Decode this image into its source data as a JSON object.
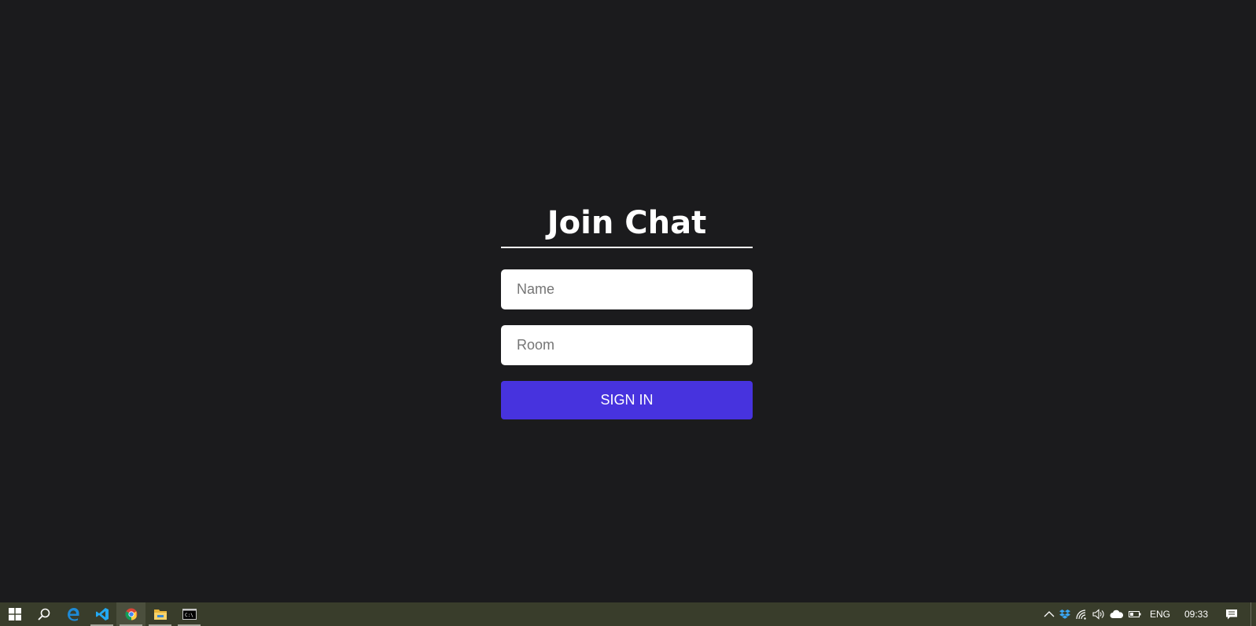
{
  "join": {
    "heading": "Join Chat",
    "name_placeholder": "Name",
    "room_placeholder": "Room",
    "submit_label": "SIGN IN"
  },
  "colors": {
    "background": "#1b1b1d",
    "accent": "#4733de",
    "taskbar": "#393d2b"
  },
  "taskbar": {
    "apps": [
      {
        "icon": "windows-start-icon"
      },
      {
        "icon": "search-icon"
      },
      {
        "icon": "edge-icon"
      },
      {
        "icon": "vscode-icon"
      },
      {
        "icon": "chrome-icon"
      },
      {
        "icon": "file-explorer-icon"
      },
      {
        "icon": "terminal-icon"
      }
    ],
    "tray": {
      "language": "ENG",
      "time": "09:33"
    }
  }
}
